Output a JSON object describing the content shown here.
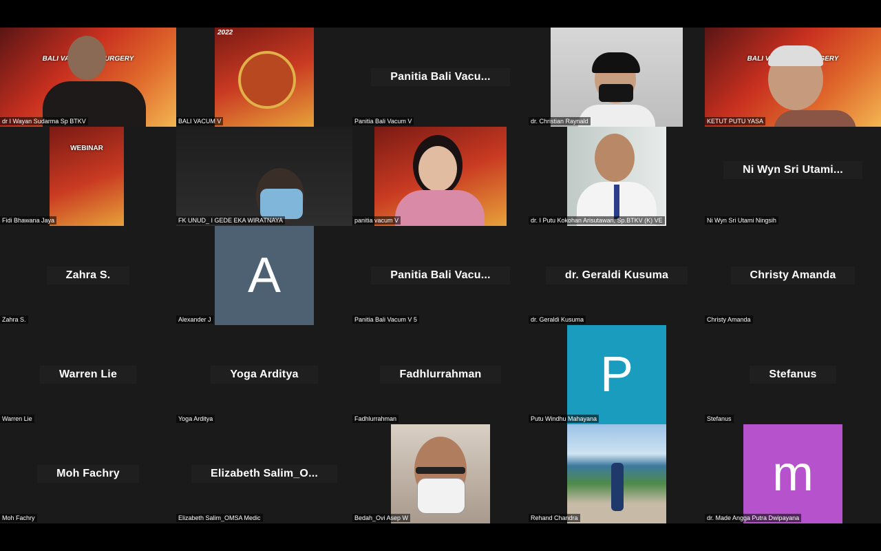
{
  "participants": [
    {
      "name": "dr I Wayan Sudarma Sp BTKV",
      "kind": "video",
      "banner": "BALI VASCULAR SURGERY"
    },
    {
      "name": "BALI VACUM V",
      "kind": "video",
      "banner": "2022"
    },
    {
      "name": "Panitia Bali Vacum V",
      "kind": "display",
      "display": "Panitia  Bali  Vacu..."
    },
    {
      "name": "dr. Christian Raynald",
      "kind": "video"
    },
    {
      "name": "KETUT PUTU YASA",
      "kind": "video",
      "banner": "BALI VASCULAR SURGERY"
    },
    {
      "name": "Fidi Bhawana Jaya",
      "kind": "video",
      "banner": "WEBINAR"
    },
    {
      "name": "FK UNUD_ I GEDE EKA WIRATNAYA",
      "kind": "video"
    },
    {
      "name": "panitia vacum V",
      "kind": "video"
    },
    {
      "name": "dr. I Putu Kokohan Arisutawan, Sp.BTKV (K) VE",
      "kind": "video"
    },
    {
      "name": "Ni Wyn Sri Utami Ningsih",
      "kind": "display",
      "display": "Ni Wyn Sri Utami..."
    },
    {
      "name": "Zahra S.",
      "kind": "display",
      "display": "Zahra S."
    },
    {
      "name": "Alexander J",
      "kind": "avatar",
      "letter": "A",
      "color": "#4e6173"
    },
    {
      "name": "Panitia Bali Vacum V 5",
      "kind": "display",
      "display": "Panitia  Bali  Vacu..."
    },
    {
      "name": "dr. Geraldi Kusuma",
      "kind": "display",
      "display": "dr. Geraldi Kusuma"
    },
    {
      "name": "Christy Amanda",
      "kind": "display",
      "display": "Christy Amanda"
    },
    {
      "name": "Warren Lie",
      "kind": "display",
      "display": "Warren Lie"
    },
    {
      "name": "Yoga Arditya",
      "kind": "display",
      "display": "Yoga Arditya"
    },
    {
      "name": "Fadhlurrahman",
      "kind": "display",
      "display": "Fadhlurrahman"
    },
    {
      "name": "Putu Windhu Mahayana",
      "kind": "avatar",
      "letter": "P",
      "color": "#1a9cbf"
    },
    {
      "name": "Stefanus",
      "kind": "display",
      "display": "Stefanus"
    },
    {
      "name": "Moh Fachry",
      "kind": "display",
      "display": "Moh Fachry"
    },
    {
      "name": "Elizabeth Salim_OMSA Medic",
      "kind": "display",
      "display": "Elizabeth  Salim_O..."
    },
    {
      "name": "Bedah_Ovi Asep W",
      "kind": "video"
    },
    {
      "name": "Rehand Chandra",
      "kind": "video"
    },
    {
      "name": "dr. Made Angga Putra Dwipayana",
      "kind": "avatar",
      "letter": "m",
      "color": "#b652cc"
    }
  ]
}
